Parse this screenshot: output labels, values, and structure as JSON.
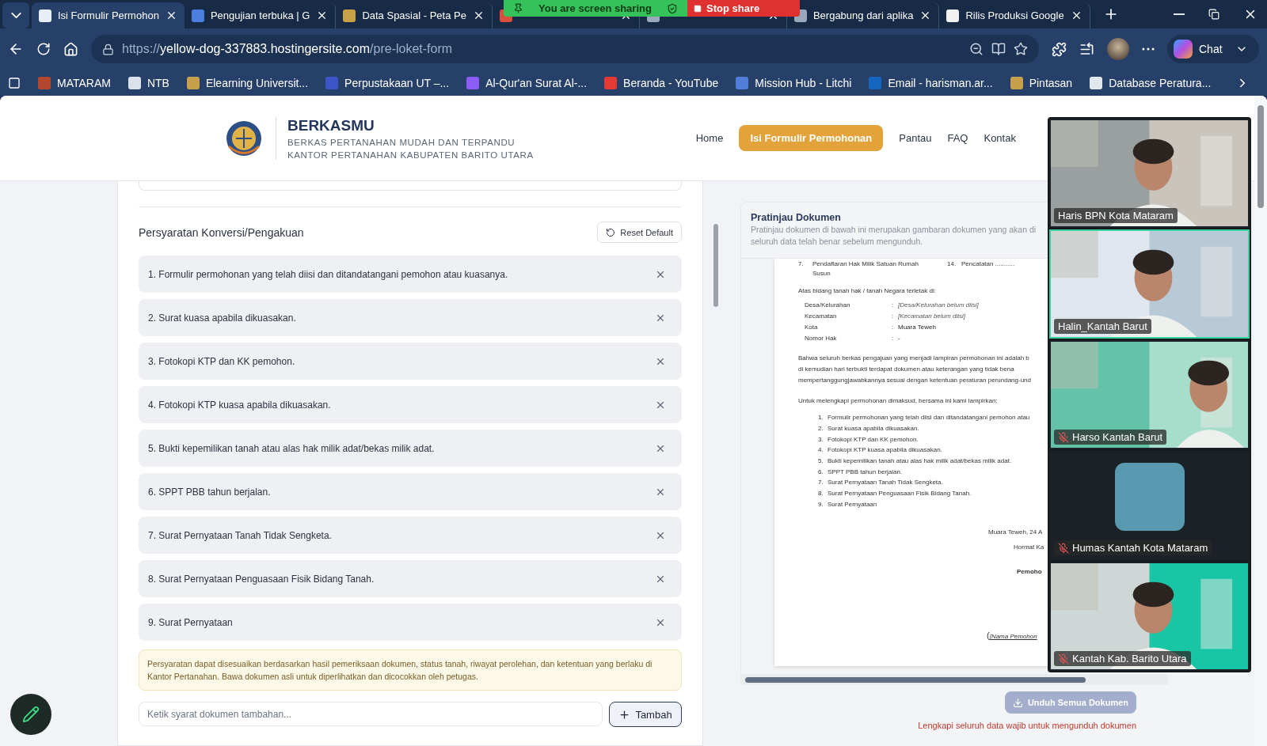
{
  "browser": {
    "tabs": [
      {
        "title": "Isi Formulir Permohon",
        "selected": true
      },
      {
        "title": "Pengujian terbuka | G",
        "selected": false
      },
      {
        "title": "Data Spasial - Peta Pe",
        "selected": false
      },
      {
        "selected": false
      },
      {
        "selected": false
      },
      {
        "title": "Bergabung dari aplika",
        "selected": false
      },
      {
        "title": "Rilis Produksi Google",
        "selected": false
      }
    ],
    "url_scheme": "https://",
    "url_host": "yellow-dog-337883.hostingersite.com",
    "url_path": "/pre-loket-form",
    "chat_label": "Chat",
    "bookmarks": [
      "MATARAM",
      "NTB",
      "Elearning Universit...",
      "Perpustakaan UT –...",
      "Al-Qur'an Surat Al-...",
      "Beranda - YouTube",
      "Mission Hub - Litchi",
      "Email - harisman.ar...",
      "Pintasan",
      "Database Peratura..."
    ]
  },
  "share_banner": {
    "status": "You are screen sharing",
    "stop_label": "Stop share"
  },
  "site": {
    "brand": "BERKASMU",
    "tagline": "BERKAS PERTANAHAN MUDAH DAN TERPANDU",
    "office": "KANTOR PERTANAHAN KABUPATEN BARITO UTARA",
    "nav": [
      {
        "label": "Home",
        "selected": false
      },
      {
        "label": "Isi Formulir Permohonan",
        "selected": true
      },
      {
        "label": "Pantau",
        "selected": false
      },
      {
        "label": "FAQ",
        "selected": false
      },
      {
        "label": "Kontak",
        "selected": false
      }
    ]
  },
  "requirements": {
    "title": "Persyaratan Konversi/Pengakuan",
    "reset_label": "Reset Default",
    "items": [
      "1. Formulir permohonan yang telah diisi dan ditandatangani pemohon atau kuasanya.",
      "2. Surat kuasa apabila dikuasakan.",
      "3. Fotokopi KTP dan KK pemohon.",
      "4. Fotokopi KTP kuasa apabila dikuasakan.",
      "5. Bukti kepemilikan tanah atau alas hak milik adat/bekas milik adat.",
      "6. SPPT PBB tahun berjalan.",
      "7. Surat Pernyataan Tanah Tidak Sengketa.",
      "8. Surat Pernyataan Penguasaan Fisik Bidang Tanah.",
      "9. Surat Pernyataan"
    ],
    "note": "Persyaratan dapat disesuaikan berdasarkan hasil pemeriksaan dokumen, status tanah, riwayat perolehan, dan ketentuan yang berlaku di Kantor Pertanahan. Bawa dokumen asli untuk diperlihatkan dan dicocokkan oleh petugas.",
    "input": {
      "placeholder": "Ketik syarat dokumen tambahan..."
    },
    "add_label": "Tambah"
  },
  "preview": {
    "title": "Pratinjau Dokumen",
    "subtitle_1": "Pratinjau dokumen di bawah ini merupakan gambaran dokumen yang akan di",
    "subtitle_2": "seluruh data telah benar sebelum mengunduh.",
    "document": {
      "service_lines": [
        {
          "number": "7.",
          "text": "Pendaftaran Hak Milik Satuan Rumah",
          "number_2": "14.",
          "text_2": "Pencatatan ..........."
        },
        {
          "text": "Susun"
        }
      ],
      "location_intro": "Atas bidang tanah hak / tanah Negara terletak di:",
      "fields": [
        {
          "label": "Desa/Kelurahan",
          "separator": ":",
          "value": "[Desa/Kelurahan belum diisi]",
          "filled": false
        },
        {
          "label": "Kecamatan",
          "separator": ":",
          "value": "[Kecamatan belum diisi]",
          "filled": false
        },
        {
          "label": "Kota",
          "separator": ":",
          "value": "Muara Teweh",
          "filled": true
        },
        {
          "label": "Nomor Hak",
          "separator": ":",
          "value": "-"
        }
      ],
      "statement": [
        "Bahwa seluruh berkas pengajuan yang menjadi lampiran permohonan ini adalah b",
        "di kemudian hari terbukti terdapat dokumen atau keterangan yang tidak bena",
        "mempertanggungjawabkannya sesuai dengan ketentuan peraturan perundang-und"
      ],
      "attach_intro": "Untuk melengkapi permohonan dimaksud, bersama ini kami lampirkan:",
      "attachments": [
        {
          "number": "1.",
          "text": "Formulir permohonan yang telah diisi dan ditandatangani pemohon atau"
        },
        {
          "number": "2.",
          "text": "Surat kuasa apabila dikuasakan."
        },
        {
          "number": "3.",
          "text": "Fotokopi KTP dan KK pemohon."
        },
        {
          "number": "4.",
          "text": "Fotokopi KTP kuasa apabila dikuasakan."
        },
        {
          "number": "5.",
          "text": "Bukti kepemilikan tanah atau alas hak milik adat/bekas milik adat."
        },
        {
          "number": "6.",
          "text": "SPPT PBB tahun berjalan."
        },
        {
          "number": "7.",
          "text": "Surat Pernyataan Tanah Tidak Sengketa."
        },
        {
          "number": "8.",
          "text": "Surat Pernyataan Penguasaan Fisik Bidang Tanah."
        },
        {
          "number": "9.",
          "text": "Surat Pernyataan"
        }
      ],
      "place_date": "Muara Teweh, 24 A",
      "closing": "Hormat Ka",
      "signer_role": "Pemoho",
      "signer_open": "(",
      "signer_name": "[Nama Pemohon"
    },
    "download_label": "Unduh Semua Dokumen",
    "warning": "Lengkapi seluruh data wajib untuk mengunduh dokumen"
  },
  "meeting": {
    "participants": [
      {
        "name": "Haris BPN Kota Mataram",
        "kind": "video",
        "muted": false,
        "speaking": false
      },
      {
        "name": "Halin_Kantah Barut",
        "kind": "video",
        "muted": false,
        "speaking": true
      },
      {
        "name": "Harso Kantah Barut",
        "kind": "video",
        "muted": true,
        "speaking": false
      },
      {
        "name": "Humas Kantah Kota Mataram",
        "kind": "avatar",
        "muted": true,
        "speaking": false
      },
      {
        "name": "Kantah Kab. Barito Utara",
        "kind": "video",
        "muted": true,
        "speaking": false
      }
    ]
  }
}
